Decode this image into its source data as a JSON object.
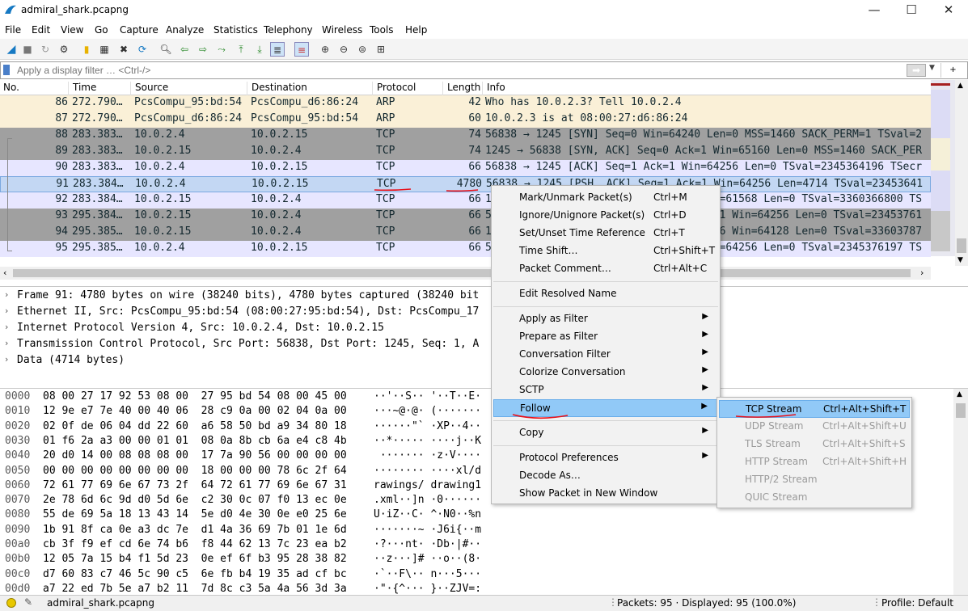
{
  "window": {
    "title": "admiral_shark.pcapng"
  },
  "menu": [
    "File",
    "Edit",
    "View",
    "Go",
    "Capture",
    "Analyze",
    "Statistics",
    "Telephony",
    "Wireless",
    "Tools",
    "Help"
  ],
  "filter": {
    "placeholder": "Apply a display filter … <Ctrl-/>"
  },
  "columns": [
    "No.",
    "Time",
    "Source",
    "Destination",
    "Protocol",
    "Length",
    "Info"
  ],
  "packets": [
    {
      "no": "86",
      "time": "272.790…",
      "src": "PcsCompu_95:bd:54",
      "dst": "PcsCompu_d6:86:24",
      "proto": "ARP",
      "len": "42",
      "info": "Who has 10.0.2.3? Tell 10.0.2.4"
    },
    {
      "no": "87",
      "time": "272.790…",
      "src": "PcsCompu_d6:86:24",
      "dst": "PcsCompu_95:bd:54",
      "proto": "ARP",
      "len": "60",
      "info": "10.0.2.3 is at 08:00:27:d6:86:24"
    },
    {
      "no": "88",
      "time": "283.383…",
      "src": "10.0.2.4",
      "dst": "10.0.2.15",
      "proto": "TCP",
      "len": "74",
      "info": "56838 → 1245 [SYN] Seq=0 Win=64240 Len=0 MSS=1460 SACK_PERM=1 TSval=2"
    },
    {
      "no": "89",
      "time": "283.383…",
      "src": "10.0.2.15",
      "dst": "10.0.2.4",
      "proto": "TCP",
      "len": "74",
      "info": "1245 → 56838 [SYN, ACK] Seq=0 Ack=1 Win=65160 Len=0 MSS=1460 SACK_PER"
    },
    {
      "no": "90",
      "time": "283.383…",
      "src": "10.0.2.4",
      "dst": "10.0.2.15",
      "proto": "TCP",
      "len": "66",
      "info": "56838 → 1245 [ACK] Seq=1 Ack=1 Win=64256 Len=0 TSval=2345364196 TSecr"
    },
    {
      "no": "91",
      "time": "283.384…",
      "src": "10.0.2.4",
      "dst": "10.0.2.15",
      "proto": "TCP",
      "len": "4780",
      "info": "56838 → 1245 [PSH, ACK] Seq=1 Ack=1 Win=64256 Len=4714 TSval=23453641"
    },
    {
      "no": "92",
      "time": "283.384…",
      "src": "10.0.2.15",
      "dst": "10.0.2.4",
      "proto": "TCP",
      "len": "66",
      "info": "1245 → 56838 [ACK] Seq=1 Ack=4715 Win=61568 Len=0 TSval=3360366800 TS"
    },
    {
      "no": "93",
      "time": "295.384…",
      "src": "10.0.2.15",
      "dst": "10.0.2.4",
      "proto": "TCP",
      "len": "66",
      "info": "56838 → 1245 [FIN, ACK] Seq=4715 Ack=1 Win=64256 Len=0 TSval=23453761"
    },
    {
      "no": "94",
      "time": "295.385…",
      "src": "10.0.2.15",
      "dst": "10.0.2.4",
      "proto": "TCP",
      "len": "66",
      "info": "1245 → 56838 [FIN, ACK] Seq=1 Ack=4716 Win=64128 Len=0 TSval=33603787"
    },
    {
      "no": "95",
      "time": "295.385…",
      "src": "10.0.2.4",
      "dst": "10.0.2.15",
      "proto": "TCP",
      "len": "66",
      "info": "56838 → 1245 [ACK] Seq=4716 Ack=2 Win=64256 Len=0 TSval=2345376197 TS"
    }
  ],
  "details": [
    "Frame 91: 4780 bytes on wire (38240 bits), 4780 bytes captured (38240 bit",
    "Ethernet II, Src: PcsCompu_95:bd:54 (08:00:27:95:bd:54), Dst: PcsCompu_17",
    "Internet Protocol Version 4, Src: 10.0.2.4, Dst: 10.0.2.15",
    "Transmission Control Protocol, Src Port: 56838, Dst Port: 1245, Seq: 1, A",
    "Data (4714 bytes)"
  ],
  "hex": [
    {
      "off": "0000",
      "hex": "08 00 27 17 92 53 08 00  27 95 bd 54 08 00 45 00",
      "ascii": "··'··S·· '··T··E·"
    },
    {
      "off": "0010",
      "hex": "12 9e e7 7e 40 00 40 06  28 c9 0a 00 02 04 0a 00",
      "ascii": "···~@·@· (·······"
    },
    {
      "off": "0020",
      "hex": "02 0f de 06 04 dd 22 60  a6 58 50 bd a9 34 80 18",
      "ascii": "······\"` ·XP··4··"
    },
    {
      "off": "0030",
      "hex": "01 f6 2a a3 00 00 01 01  08 0a 8b cb 6a e4 c8 4b",
      "ascii": "··*····· ····j··K"
    },
    {
      "off": "0040",
      "hex": "20 d0 14 00 08 08 08 00  17 7a 90 56 00 00 00 00",
      "ascii": " ······· ·z·V····"
    },
    {
      "off": "0050",
      "hex": "00 00 00 00 00 00 00 00  18 00 00 00 78 6c 2f 64",
      "ascii": "········ ····xl/d"
    },
    {
      "off": "0060",
      "hex": "72 61 77 69 6e 67 73 2f  64 72 61 77 69 6e 67 31",
      "ascii": "rawings/ drawing1"
    },
    {
      "off": "0070",
      "hex": "2e 78 6d 6c 9d d0 5d 6e  c2 30 0c 07 f0 13 ec 0e",
      "ascii": ".xml··]n ·0······"
    },
    {
      "off": "0080",
      "hex": "55 de 69 5a 18 13 43 14  5e d0 4e 30 0e e0 25 6e",
      "ascii": "U·iZ··C· ^·N0··%n"
    },
    {
      "off": "0090",
      "hex": "1b 91 8f ca 0e a3 dc 7e  d1 4a 36 69 7b 01 1e 6d",
      "ascii": "·······~ ·J6i{··m"
    },
    {
      "off": "00a0",
      "hex": "cb 3f f9 ef cd 6e 74 b6  f8 44 62 13 7c 23 ea b2",
      "ascii": "·?···nt· ·Db·|#··"
    },
    {
      "off": "00b0",
      "hex": "12 05 7a 15 b4 f1 5d 23  0e ef 6f b3 95 28 38 82",
      "ascii": "··z···]# ··o··(8·"
    },
    {
      "off": "00c0",
      "hex": "d7 60 83 c7 46 5c 90 c5  6e fb b4 19 35 ad cf bc",
      "ascii": "·`··F\\·· n···5···"
    },
    {
      "off": "00d0",
      "hex": "a7 22 ed 7b 5e a7 b2 11  7d 8c c3 5a 4a 56 3d 3a",
      "ascii": "·\"·{^··· }··ZJV=:"
    }
  ],
  "context_menu": {
    "items": [
      {
        "label": "Mark/Unmark Packet(s)",
        "shortcut": "Ctrl+M"
      },
      {
        "label": "Ignore/Unignore Packet(s)",
        "shortcut": "Ctrl+D"
      },
      {
        "label": "Set/Unset Time Reference",
        "shortcut": "Ctrl+T"
      },
      {
        "label": "Time Shift…",
        "shortcut": "Ctrl+Shift+T"
      },
      {
        "label": "Packet Comment…",
        "shortcut": "Ctrl+Alt+C"
      },
      {
        "sep": true
      },
      {
        "label": "Edit Resolved Name",
        "shortcut": ""
      },
      {
        "sep": true
      },
      {
        "label": "Apply as Filter",
        "sub": true
      },
      {
        "label": "Prepare as Filter",
        "sub": true
      },
      {
        "label": "Conversation Filter",
        "sub": true
      },
      {
        "label": "Colorize Conversation",
        "sub": true
      },
      {
        "label": "SCTP",
        "sub": true
      },
      {
        "label": "Follow",
        "sub": true,
        "active": true
      },
      {
        "sep": true
      },
      {
        "label": "Copy",
        "sub": true
      },
      {
        "sep": true
      },
      {
        "label": "Protocol Preferences",
        "sub": true
      },
      {
        "label": "Decode As…"
      },
      {
        "label": "Show Packet in New Window"
      }
    ]
  },
  "submenu": {
    "items": [
      {
        "label": "TCP Stream",
        "shortcut": "Ctrl+Alt+Shift+T",
        "enabled": true
      },
      {
        "label": "UDP Stream",
        "shortcut": "Ctrl+Alt+Shift+U",
        "enabled": false
      },
      {
        "label": "TLS Stream",
        "shortcut": "Ctrl+Alt+Shift+S",
        "enabled": false
      },
      {
        "label": "HTTP Stream",
        "shortcut": "Ctrl+Alt+Shift+H",
        "enabled": false
      },
      {
        "label": "HTTP/2 Stream",
        "shortcut": "",
        "enabled": false
      },
      {
        "label": "QUIC Stream",
        "shortcut": "",
        "enabled": false
      }
    ]
  },
  "status": {
    "file": "admiral_shark.pcapng",
    "packets": "Packets: 95 · Displayed: 95 (100.0%)",
    "profile": "Profile: Default"
  },
  "colors": {
    "arp": "#faf0d7",
    "tcp_dark": "#a0a0a0",
    "tcp_light": "#e7e6ff",
    "selected": "#c3d7f3",
    "menu_hl": "#91c9f7",
    "annotation": "#e8101a"
  }
}
